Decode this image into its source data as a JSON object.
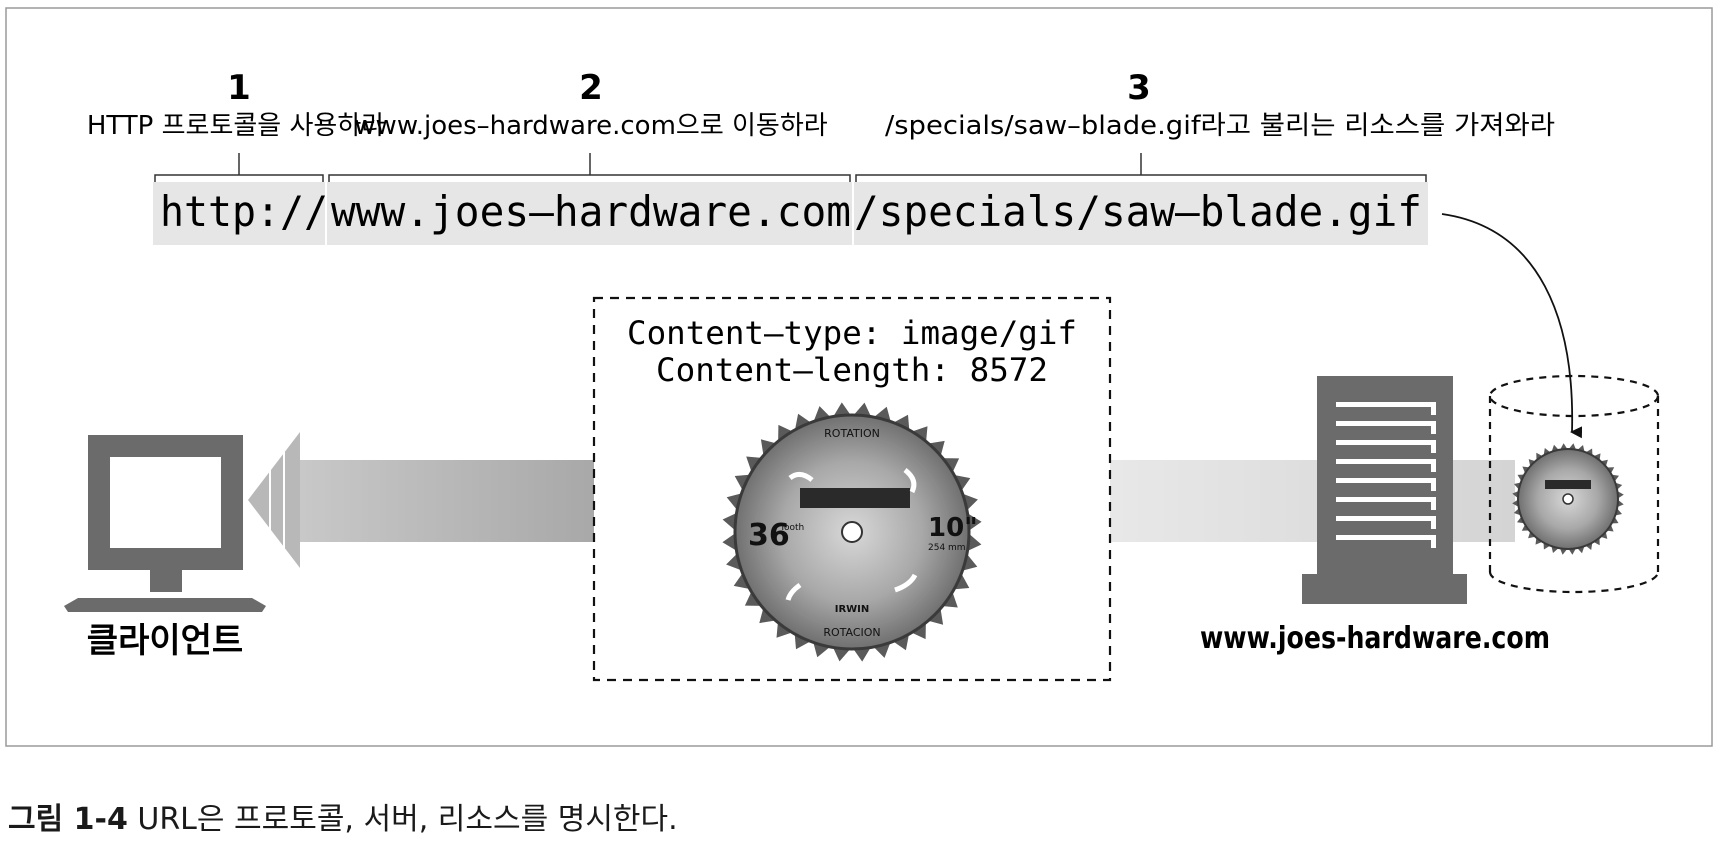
{
  "steps": [
    {
      "number": "1",
      "text": "HTTP 프로토콜을 사용하라"
    },
    {
      "number": "2",
      "text": "www.joes–hardware.com으로 이동하라"
    },
    {
      "number": "3",
      "text": "/specials/saw–blade.gif라고 불리는 리소스를 가져와라"
    }
  ],
  "url": {
    "scheme": "http://",
    "host": "www.joes–hardware.com",
    "path": "/specials/saw–blade.gif"
  },
  "response": {
    "content_type": "Content–type: image/gif",
    "content_length": "Content–length: 8572"
  },
  "blade": {
    "top_label": "ROTATION",
    "bottom_label": "ROTACION",
    "teeth_count": "36",
    "teeth_word": "Tooth",
    "size": "10\"",
    "size_mm": "254 mm",
    "brand": "IRWIN"
  },
  "client_label": "클라이언트",
  "server_label": "www.joes-hardware.com",
  "caption": {
    "figure_no": "그림 1-4",
    "text": " URL은 프로토콜, 서버, 리소스를 명시한다."
  },
  "colors": {
    "dark_gray": "#6b6b6b",
    "arrow_gray": "#b4b4b4",
    "url_bg": "#e6e6e6",
    "frame": "#9a9a9a"
  }
}
